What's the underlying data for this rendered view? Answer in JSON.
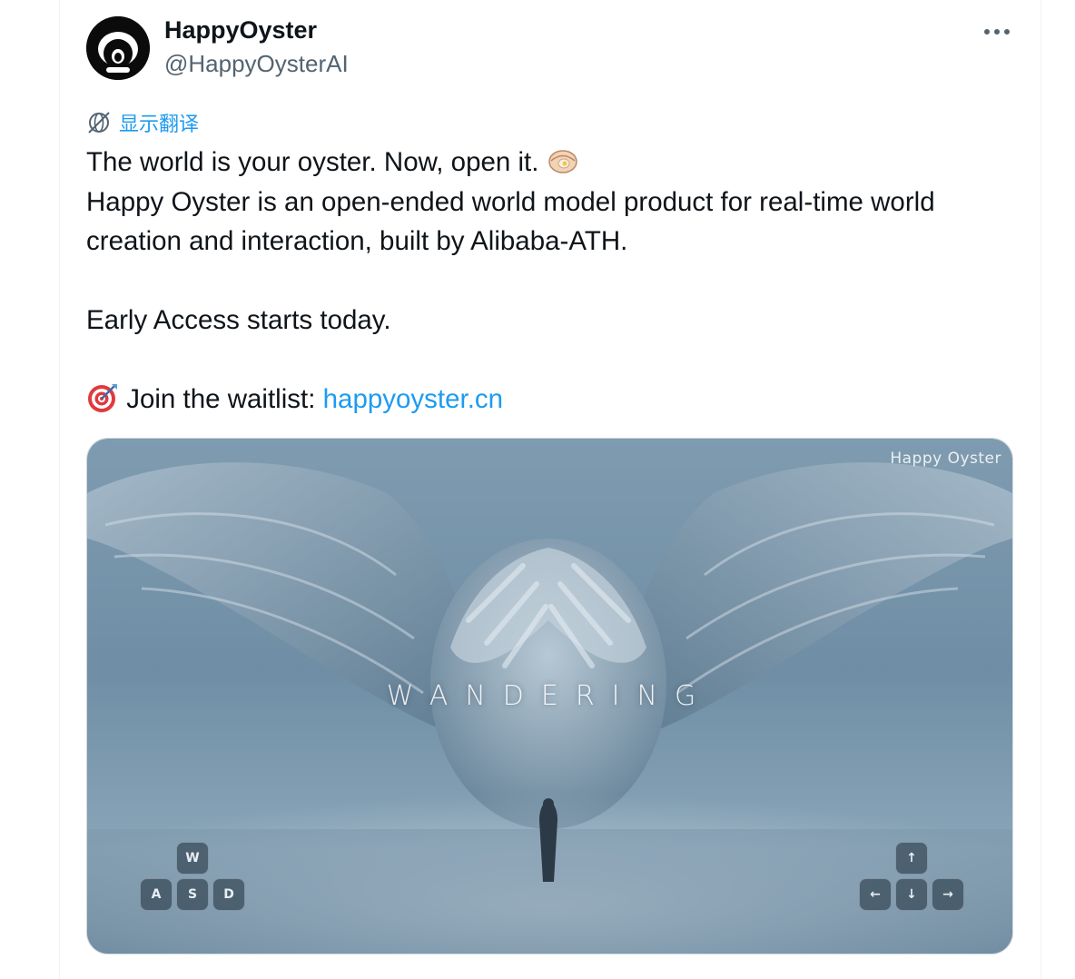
{
  "author": {
    "name": "HappyOyster",
    "handle": "@HappyOysterAI"
  },
  "menu": {
    "more_label": "···"
  },
  "translate": {
    "label": "显示翻译"
  },
  "tweet": {
    "line1": "The world is your oyster. Now, open it.",
    "line1_emoji": "oyster-emoji",
    "line2": "Happy Oyster is an open-ended world model product for real-time world",
    "line3": "creation and interaction, built by Alibaba-ATH.",
    "line4": "Early Access starts today.",
    "line5_emoji": "direct-hit-emoji",
    "line5_prefix": "Join the waitlist: ",
    "link": "happyoyster.cn"
  },
  "media": {
    "watermark": "Happy Oyster",
    "overlay_title": "WANDERING",
    "keys_left": {
      "w": "W",
      "a": "A",
      "s": "S",
      "d": "D"
    },
    "keys_right": {
      "up": "↑",
      "left": "←",
      "down": "↓",
      "right": "→"
    }
  },
  "colors": {
    "text": "#0f1419",
    "secondary": "#536471",
    "accent": "#1d9bf0",
    "border": "#eff3f4"
  }
}
